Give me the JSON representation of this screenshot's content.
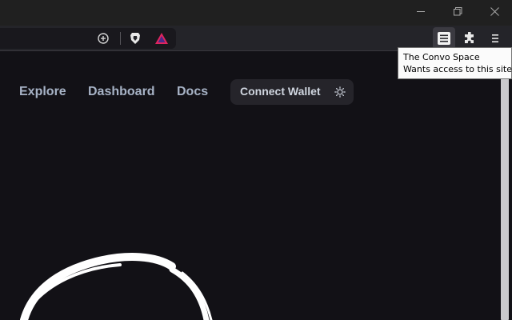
{
  "window": {
    "minimize_icon": "minimize-icon",
    "restore_icon": "restore-icon",
    "close_icon": "close-icon"
  },
  "toolbar": {
    "url_icons": [
      "zoom-plus-icon",
      "brave-shields-icon",
      "brave-rewards-icon"
    ],
    "extensions": [
      "convo-space-extension-icon",
      "puzzle-extensions-icon",
      "hamburger-menu-icon"
    ]
  },
  "tooltip": {
    "line1": "The Convo Space",
    "line2": "Wants access to this site"
  },
  "nav": {
    "links": [
      "Explore",
      "Dashboard",
      "Docs"
    ],
    "connect_wallet": "Connect Wallet",
    "theme_icon": "sun-icon"
  },
  "colors": {
    "background": "#121116",
    "nav_text": "#a7b3c6",
    "button_bg": "#25242a",
    "tooltip_bg": "#fbfbfb"
  }
}
